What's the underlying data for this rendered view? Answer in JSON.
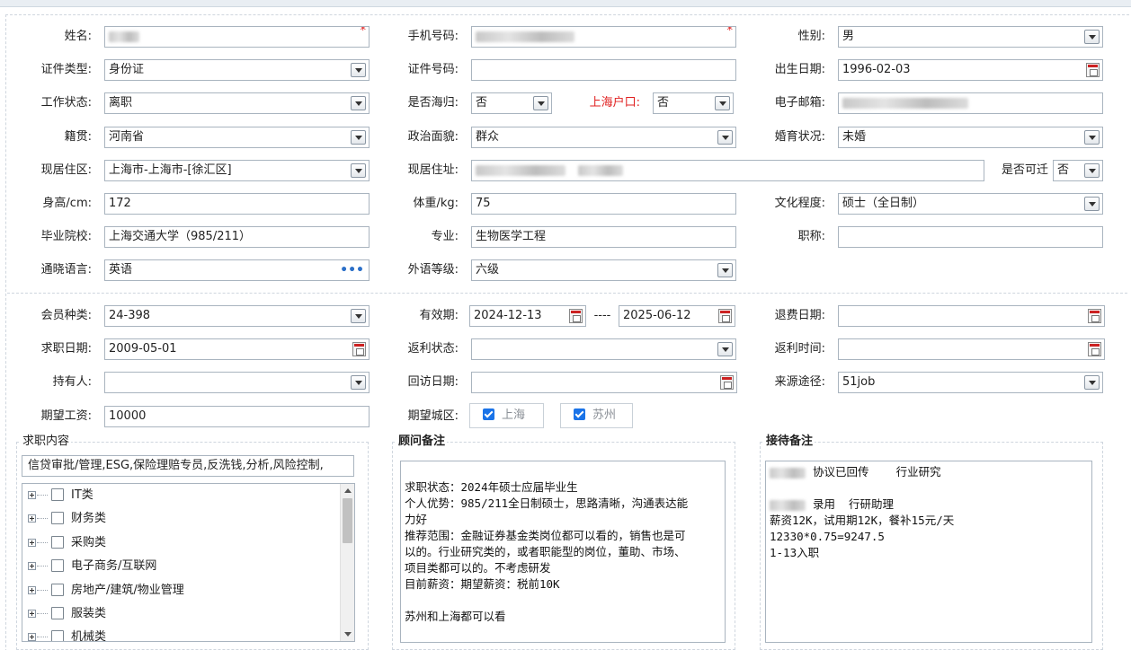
{
  "form": {
    "name": {
      "label": "姓名:",
      "value": "",
      "required": "*"
    },
    "phone": {
      "label": "手机号码:",
      "value": "",
      "required": "*"
    },
    "gender": {
      "label": "性别:",
      "value": "男"
    },
    "id_type": {
      "label": "证件类型:",
      "value": "身份证"
    },
    "id_number": {
      "label": "证件号码:",
      "value": ""
    },
    "birth_date": {
      "label": "出生日期:",
      "value": "1996-02-03"
    },
    "work_status": {
      "label": "工作状态:",
      "value": "离职"
    },
    "overseas_return": {
      "label": "是否海归:",
      "value": "否"
    },
    "shanghai_hukou": {
      "label": "上海户口:",
      "value": "否"
    },
    "email": {
      "label": "电子邮箱:",
      "value": ""
    },
    "native_place": {
      "label": "籍贯:",
      "value": "河南省"
    },
    "political_status": {
      "label": "政治面貌:",
      "value": "群众"
    },
    "marital_status": {
      "label": "婚育状况:",
      "value": "未婚"
    },
    "residence_area": {
      "label": "现居住区:",
      "value": "上海市-上海市-[徐汇区]"
    },
    "residence_address": {
      "label": "现居住址:",
      "value": ""
    },
    "relocatable": {
      "label": "是否可迁",
      "value": "否"
    },
    "height": {
      "label": "身高/cm:",
      "value": "172"
    },
    "weight": {
      "label": "体重/kg:",
      "value": "75"
    },
    "education": {
      "label": "文化程度:",
      "value": "硕士（全日制）"
    },
    "school": {
      "label": "毕业院校:",
      "value": "上海交通大学（985/211）"
    },
    "major": {
      "label": "专业:",
      "value": "生物医学工程"
    },
    "title": {
      "label": "职称:",
      "value": ""
    },
    "languages": {
      "label": "通晓语言:",
      "value": "英语",
      "more": "•••"
    },
    "language_level": {
      "label": "外语等级:",
      "value": "六级"
    }
  },
  "membership": {
    "member_type": {
      "label": "会员种类:",
      "value": "24-398"
    },
    "validity": {
      "label": "有效期:",
      "start": "2024-12-13",
      "sep": "----",
      "end": "2025-06-12"
    },
    "refund_date": {
      "label": "退费日期:",
      "value": ""
    },
    "job_search_date": {
      "label": "求职日期:",
      "value": "2009-05-01"
    },
    "rebate_status": {
      "label": "返利状态:",
      "value": ""
    },
    "rebate_time": {
      "label": "返利时间:",
      "value": ""
    },
    "holder": {
      "label": "持有人:",
      "value": ""
    },
    "revisit_date": {
      "label": "回访日期:",
      "value": ""
    },
    "source": {
      "label": "来源途径:",
      "value": "51job"
    },
    "expected_salary": {
      "label": "期望工资:",
      "value": "10000"
    },
    "expected_city": {
      "label": "期望城区:",
      "options": [
        {
          "label": "上海",
          "checked": true
        },
        {
          "label": "苏州",
          "checked": true
        }
      ]
    }
  },
  "job_content": {
    "legend": "求职内容",
    "selected": "信贷审批/管理,ESG,保险理赔专员,反洗钱,分析,风险控制,",
    "tree": [
      "IT类",
      "财务类",
      "采购类",
      "电子商务/互联网",
      "房地产/建筑/物业管理",
      "服装类",
      "机械类"
    ]
  },
  "consultant_notes": {
    "legend": "顾问备注",
    "lines": [
      "",
      "求职状态：2024年硕士应届毕业生",
      "个人优势：985/211全日制硕士，思路清晰，沟通表达能",
      "力好",
      "推荐范围：金融证券基金类岗位都可以看的，销售也是可",
      "以的。行业研究类的，或者职能型的岗位，董助、市场、",
      "项目类都可以的。不考虑研发",
      "目前薪资：期望薪资：税前10K",
      "",
      "苏州和上海都可以看"
    ]
  },
  "reception_notes": {
    "legend": "接待备注",
    "lines": [
      "协议已回传    行业研究",
      "",
      "录用  行研助理",
      "薪资12K，试用期12K，餐补15元/天",
      "12330*0.75=9247.5",
      "1-13入职"
    ]
  }
}
